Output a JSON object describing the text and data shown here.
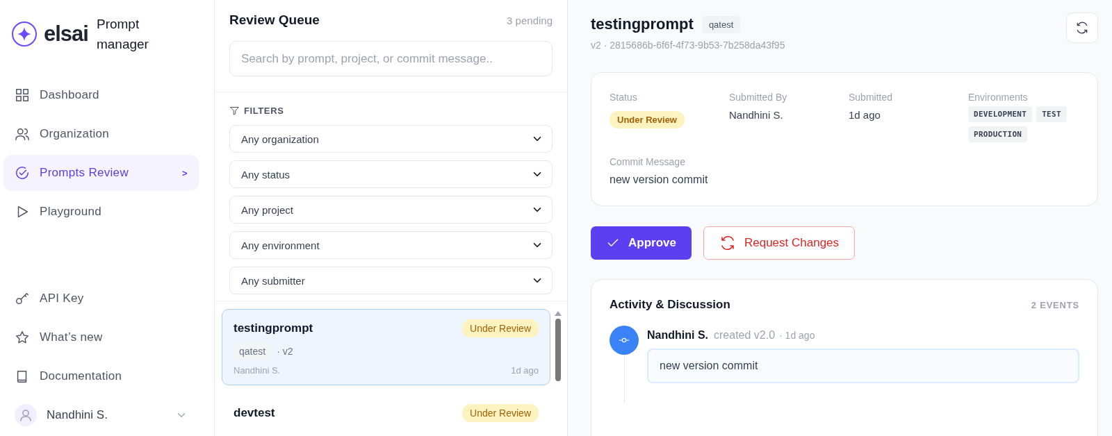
{
  "sidebar": {
    "logo": {
      "wordmark": "elsai",
      "product": "Prompt manager"
    },
    "nav_items": [
      {
        "label": "Dashboard",
        "selected": false
      },
      {
        "label": "Organization",
        "selected": false
      },
      {
        "label": "Prompts Review",
        "selected": true,
        "chevron": ">"
      },
      {
        "label": "Playground",
        "selected": false
      }
    ],
    "footer_items": [
      {
        "label": "API Key"
      },
      {
        "label": "What’s new"
      },
      {
        "label": "Documentation"
      }
    ],
    "user": {
      "name": "Nandhini S."
    }
  },
  "queue": {
    "title": "Review Queue",
    "count": "3 pending",
    "search": {
      "placeholder": "Search by prompt, project, or commit message.."
    },
    "filters": {
      "label": "FILTERS",
      "selects": [
        "Any organization",
        "Any status",
        "Any project",
        "Any environment",
        "Any submitter"
      ]
    },
    "items": [
      {
        "title": "testingprompt",
        "status": "Under Review",
        "project": "qatest",
        "version": "· v2",
        "submitter": "Nandhini S.",
        "time": "1d ago",
        "selected": true
      },
      {
        "title": "devtest",
        "status": "Under Review",
        "selected": false
      }
    ]
  },
  "detail": {
    "title": "testingprompt",
    "project": "qatest",
    "meta": "v2 · 2815686b-6f6f-4f73-9b53-7b258da43f95",
    "fields": [
      {
        "kind": "badge",
        "label": "Status",
        "value": "Under Review"
      },
      {
        "kind": "text",
        "label": "Submitted By",
        "value": "Nandhini S."
      },
      {
        "kind": "text",
        "label": "Submitted",
        "value": "1d ago"
      },
      {
        "kind": "tags",
        "label": "Environments",
        "values": [
          "DEVELOPMENT",
          "TEST",
          "PRODUCTION"
        ]
      }
    ],
    "commit": {
      "label": "Commit Message",
      "value": "new version commit"
    },
    "actions": [
      {
        "kind": "approve",
        "label": "Approve"
      },
      {
        "kind": "request",
        "label": "Request Changes"
      }
    ],
    "activity": {
      "title": "Activity & Discussion",
      "count": "2 EVENTS",
      "events": [
        {
          "author": "Nandhini S.",
          "action": "created v2.0",
          "time": "· 1d ago",
          "comment": "new version commit",
          "color": "#3b82f6"
        }
      ]
    }
  }
}
